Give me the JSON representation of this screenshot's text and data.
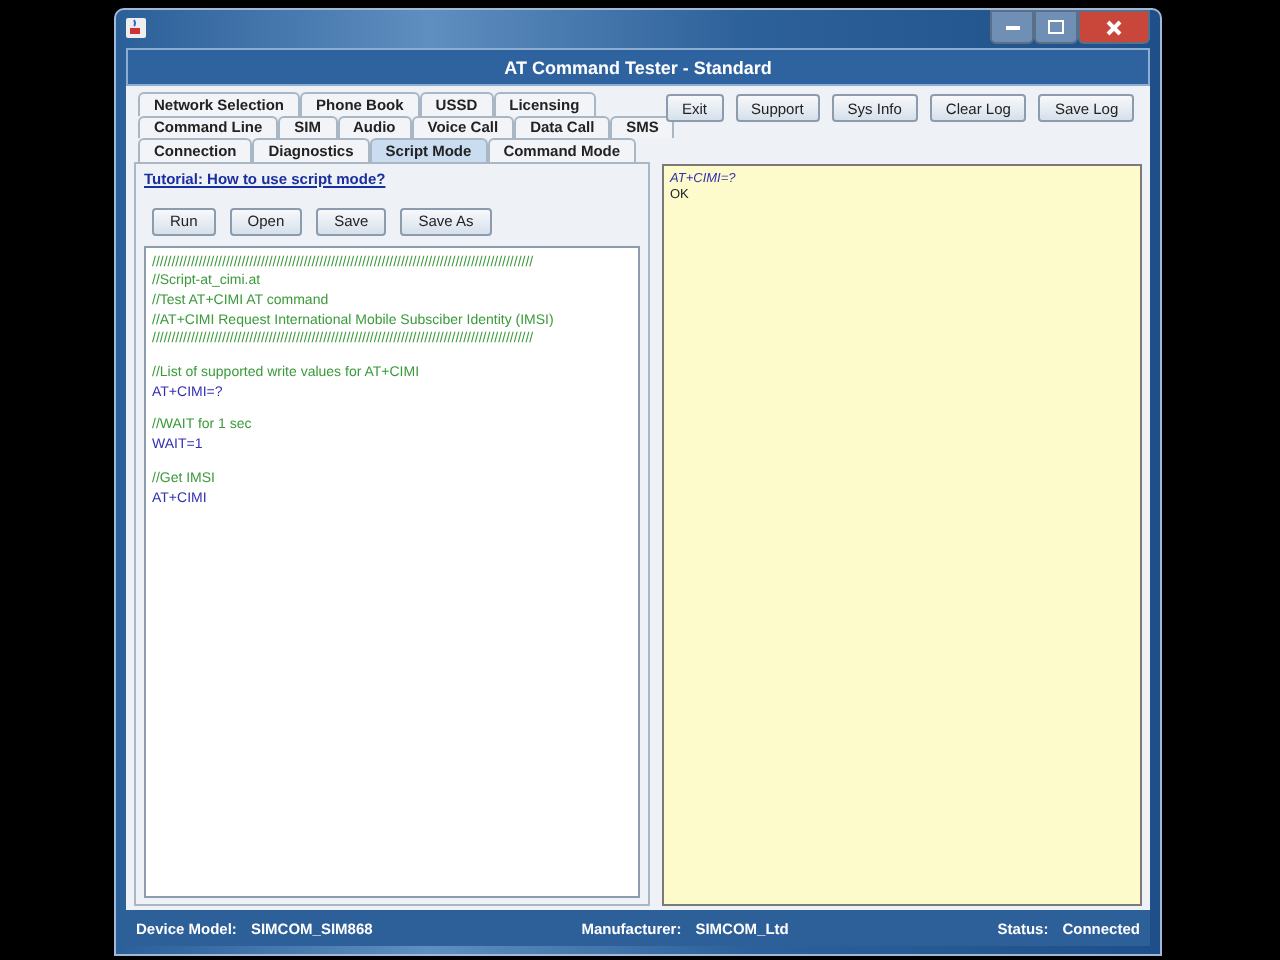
{
  "window": {
    "title": "AT Command Tester - Standard"
  },
  "tab_rows": [
    {
      "tabs": [
        {
          "label": "Network Selection",
          "selected": false
        },
        {
          "label": "Phone Book",
          "selected": false
        },
        {
          "label": "USSD",
          "selected": false
        },
        {
          "label": "Licensing",
          "selected": false
        }
      ]
    },
    {
      "tabs": [
        {
          "label": "Command Line",
          "selected": false
        },
        {
          "label": "SIM",
          "selected": false
        },
        {
          "label": "Audio",
          "selected": false
        },
        {
          "label": "Voice Call",
          "selected": false
        },
        {
          "label": "Data Call",
          "selected": false
        },
        {
          "label": "SMS",
          "selected": false
        }
      ]
    },
    {
      "tabs": [
        {
          "label": "Connection",
          "selected": false
        },
        {
          "label": "Diagnostics",
          "selected": false
        },
        {
          "label": "Script Mode",
          "selected": true
        },
        {
          "label": "Command Mode",
          "selected": false
        }
      ]
    }
  ],
  "tutorial_link": "Tutorial: How to use script mode?",
  "script_buttons": [
    "Run",
    "Open",
    "Save",
    "Save As"
  ],
  "script_blocks": [
    {
      "lines": [
        {
          "kind": "comment",
          "text": "//////////////////////////////////////////////////////////////////////////////////////////////////"
        },
        {
          "kind": "comment",
          "text": "//Script-at_cimi.at"
        },
        {
          "kind": "comment",
          "text": "//Test AT+CIMI AT command"
        },
        {
          "kind": "comment",
          "text": "//AT+CIMI Request International Mobile Subsciber Identity (IMSI)"
        },
        {
          "kind": "comment",
          "text": "//////////////////////////////////////////////////////////////////////////////////////////////////"
        }
      ]
    },
    {
      "lines": [
        {
          "kind": "comment",
          "text": "//List of supported write values for AT+CIMI"
        },
        {
          "kind": "command",
          "text": "AT+CIMI=?"
        }
      ]
    },
    {
      "lines": [
        {
          "kind": "comment",
          "text": "//WAIT for 1 sec"
        },
        {
          "kind": "command",
          "text": "WAIT=1"
        }
      ]
    },
    {
      "lines": [
        {
          "kind": "comment",
          "text": "//Get IMSI"
        },
        {
          "kind": "command",
          "text": "AT+CIMI"
        }
      ]
    }
  ],
  "log_buttons": [
    "Exit",
    "Support",
    "Sys Info",
    "Clear Log",
    "Save Log"
  ],
  "log_lines": [
    {
      "kind": "command",
      "text": "AT+CIMI=?"
    },
    {
      "kind": "response",
      "text": "OK"
    }
  ],
  "status_bar": [
    {
      "label": "Device Model:",
      "value": "SIMCOM_SIM868"
    },
    {
      "label": "Manufacturer:",
      "value": "SIMCOM_Ltd"
    },
    {
      "label": "Status:",
      "value": "Connected"
    }
  ]
}
